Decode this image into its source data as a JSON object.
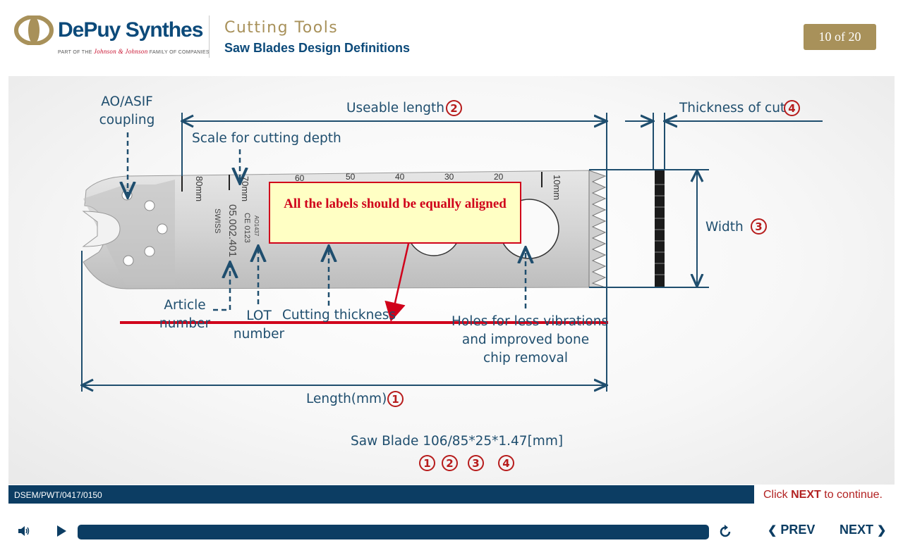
{
  "header": {
    "brand": "DePuy Synthes",
    "brand_sub_prefix": "PART OF THE",
    "brand_sub_jj": "Johnson & Johnson",
    "brand_sub_suffix": "FAMILY OF COMPANIES",
    "course_title": "Cutting Tools",
    "slide_subtitle": "Saw Blades Design Definitions",
    "page_counter": "10 of 20"
  },
  "diagram": {
    "labels": {
      "coupling_line1": "AO/ASIF",
      "coupling_line2": "coupling",
      "useable_length": "Useable length",
      "thickness_of_cut": "Thickness of cut",
      "scale": "Scale for cutting depth",
      "width": "Width",
      "article_line1": "Article",
      "article_line2": "number",
      "lot_line1": "LOT",
      "lot_line2": "number",
      "cutting_thickness": "Cutting thickness",
      "holes_line1": "Holes for less vibrations",
      "holes_line2": "and improved bone",
      "holes_line3": "chip removal",
      "length": "Length(mm)",
      "spec": "Saw Blade 106/85*25*1.47[mm]"
    },
    "numbers": {
      "length": "1",
      "useable_length": "2",
      "width": "3",
      "thickness_of_cut": "4",
      "spec": [
        "1",
        "2",
        "3",
        "4"
      ]
    },
    "blade_text": {
      "swiss": "SWISS",
      "article": "05.002.401",
      "ce": "CE 0123",
      "ao": "AO1437",
      "scale_80": "80mm",
      "scale_70": "70mm",
      "scale_10": "10mm",
      "scale_60": "60",
      "scale_50": "50",
      "scale_40": "40",
      "scale_30": "30",
      "scale_20": "20"
    },
    "annotation": "All the labels should be equally aligned",
    "colors": {
      "accent_red": "#d0021b",
      "navy": "#0c3d63",
      "gold": "#a8915a"
    }
  },
  "footer": {
    "doc_code": "DSEM/PWT/0417/0150",
    "continue_prefix": "Click",
    "continue_next": "NEXT",
    "continue_suffix": "to continue.",
    "prev_label": "PREV",
    "next_label": "NEXT",
    "icons": [
      "speaker-icon",
      "play-icon",
      "replay-icon",
      "chevron-left-icon",
      "chevron-right-icon"
    ]
  }
}
